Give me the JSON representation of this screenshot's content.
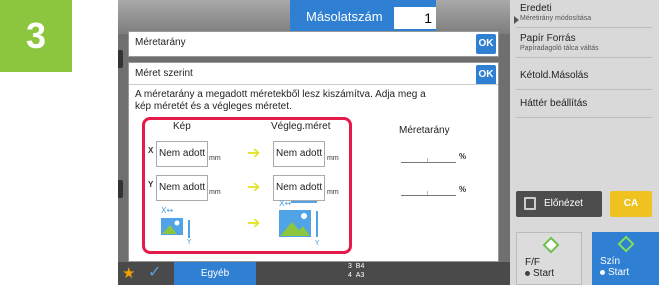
{
  "step": "3",
  "header": {
    "copies_label": "Másolatszám",
    "copies_value": "1"
  },
  "right_menu": [
    {
      "label": "Eredeti",
      "sub": "Méretirány módosítása"
    },
    {
      "label": "Papír Forrás",
      "sub": "Papíradagoló tálca váltás"
    },
    {
      "label": "Kétold.Másolás",
      "sub": ""
    },
    {
      "label": "Háttér beállítás",
      "sub": ""
    }
  ],
  "preview_label": "Előnézet",
  "ca_label": "CA",
  "start_bw": {
    "mode": "F/F",
    "label": "Start"
  },
  "start_color": {
    "mode": "Szín",
    "label": "Start"
  },
  "bottom": {
    "other_label": "Egyéb",
    "tray_3": "3",
    "tray_3_size": "B4",
    "tray_4": "4",
    "tray_4_size": "A3"
  },
  "panel_ratio": {
    "title": "Méretarány",
    "ok": "OK"
  },
  "panel_size": {
    "title": "Méret szerint",
    "ok": "OK",
    "description": "A méretarány a megadott méretekből lesz kiszámítva. Adja meg a kép méretét és a végleges méretet.",
    "image_header": "Kép",
    "final_header": "Végleg.méret",
    "ratio_header": "Méretarány",
    "x_label": "X",
    "y_label": "Y",
    "x_image": "Nem adott",
    "x_final": "Nem adott",
    "y_image": "Nem adott",
    "y_final": "Nem adott",
    "unit": "mm",
    "percent": "%"
  }
}
